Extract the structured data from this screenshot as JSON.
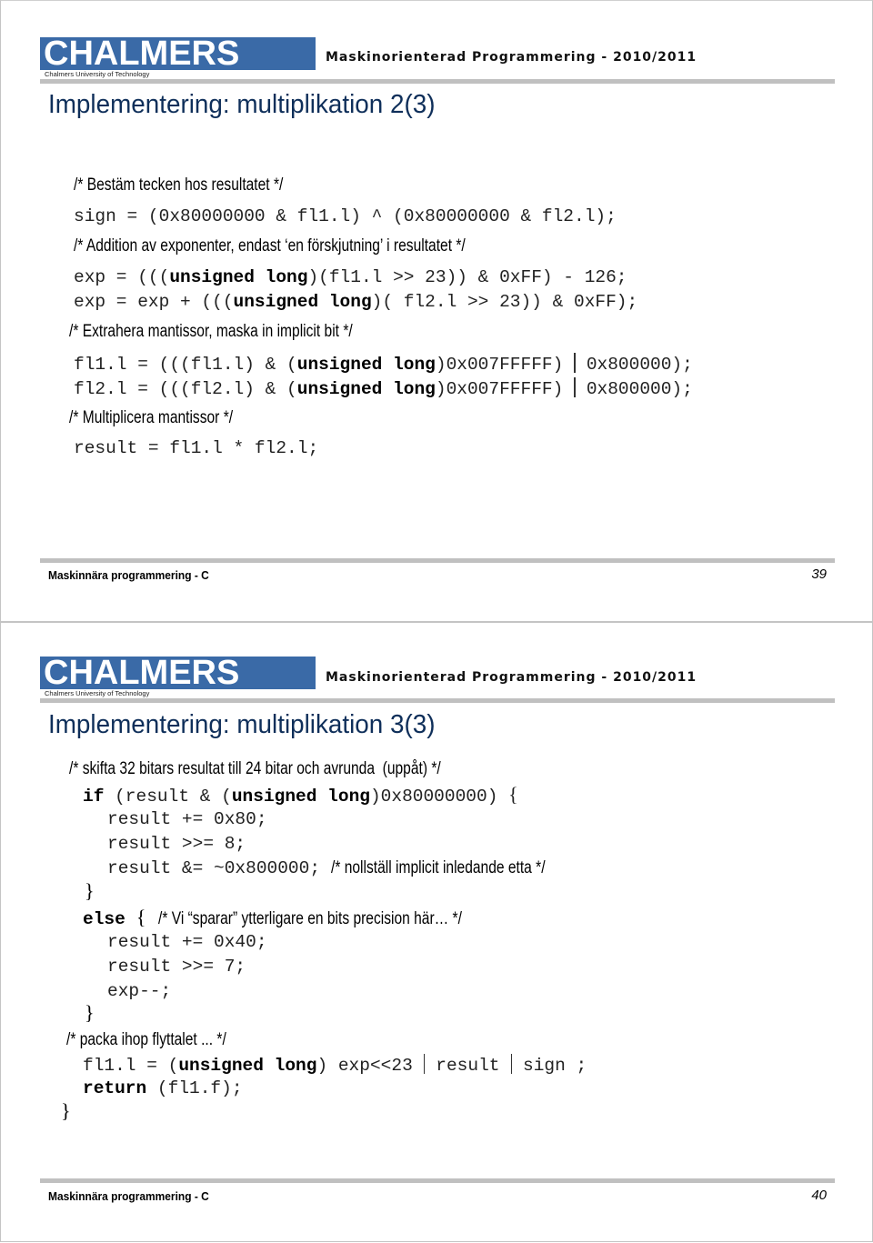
{
  "header": {
    "logo_text": "CHALMERS",
    "logo_subtitle": "Chalmers University of Technology",
    "course_title": "Maskinorienterad Programmering - 2010/2011",
    "logo_color": "#3a6aa7"
  },
  "slides": [
    {
      "title": "Implementering: multiplikation 2(3)",
      "lines": {
        "c1": "/* Bestäm tecken hos resultatet */",
        "l1": "sign = (0x80000000 & fl1.l) ^ (0x80000000 & fl2.l);",
        "c2": "/* Addition av exponenter, endast ‘en förskjutning’ i resultatet */",
        "l2a": "exp = (((",
        "l2kw": "unsigned long",
        "l2b": ")(fl1.l >> 23)) & 0xFF) - 126;",
        "l3a": "exp = exp + (((",
        "l3kw": "unsigned long",
        "l3b": ")( fl2.l >> 23)) & 0xFF);",
        "c3": "/* Extrahera mantissor, maska in implicit bit */",
        "l4a": "fl1.l = (((fl1.l) & (",
        "l4kw": "unsigned long",
        "l4b": ")0x007FFFFF)",
        "l4c": "0x800000);",
        "l5a": "fl2.l = (((fl2.l) & (",
        "l5kw": "unsigned long",
        "l5b": ")0x007FFFFF)",
        "l5c": "0x800000);",
        "c4": "/* Multiplicera mantissor */",
        "l6": "result = fl1.l * fl2.l;"
      },
      "footer": "Maskinnära programmering - C",
      "page_number": "39"
    },
    {
      "title": "Implementering: multiplikation 3(3)",
      "lines": {
        "c1": "/* skifta 32 bitars resultat till 24 bitar och avrunda  (uppåt) */",
        "if_kw": "if",
        "if_a": " (result & (",
        "if_kw2": "unsigned long",
        "if_b": ")0x80000000) ",
        "open_brace": "{",
        "r1": "result += 0x80;",
        "r2": "result >>= 8;",
        "r3": "result &= ~0x800000; ",
        "r3c": "/* nollställ implicit inledande etta */",
        "close_brace": "}",
        "else_kw": "else",
        "else_c": "/* Vi “sparar” ytterligare en bits precision här… */",
        "e1": "result += 0x40;",
        "e2": "result >>= 7;",
        "e3": "exp--;",
        "c2": "/* packa ihop flyttalet ... */",
        "p1a": "fl1.l = (",
        "p1kw": "unsigned long",
        "p1b": ") exp<<23",
        "p1c": "result",
        "p1d": "sign ;",
        "ret_kw": "return",
        "ret": " (fl1.f);",
        "end_brace": "}"
      },
      "footer": "Maskinnära programmering - C",
      "page_number": "40"
    }
  ]
}
